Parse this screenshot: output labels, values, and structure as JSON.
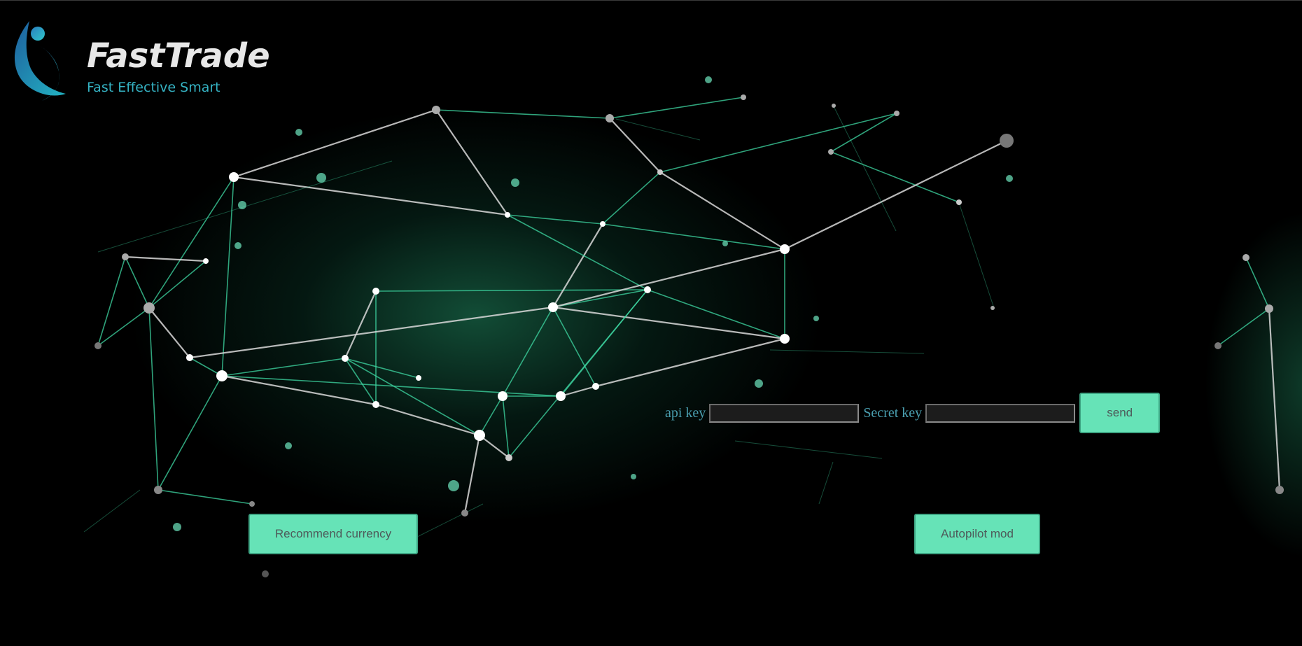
{
  "brand": {
    "title": "FastTrade",
    "tagline": "Fast Effective Smart",
    "logo_icon": "fasttrade-logo-icon"
  },
  "key_form": {
    "api_key_label": "api key",
    "api_key_value": "",
    "secret_key_label": "Secret key",
    "secret_key_value": "",
    "send_label": "send"
  },
  "actions": {
    "recommend_label": "Recommend currency",
    "autopilot_label": "Autopilot mod"
  },
  "colors": {
    "background": "#000000",
    "accent_button": "#66e3b7",
    "tagline": "#35b3c4",
    "form_label": "#4a9fb0",
    "network_line": "#3fd9a4"
  }
}
